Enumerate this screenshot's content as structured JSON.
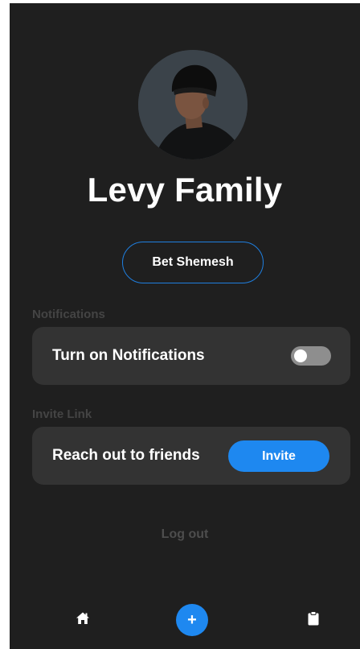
{
  "profile": {
    "family_name": "Levy Family",
    "location": "Bet Shemesh",
    "avatar_icon": "profile-photo"
  },
  "notifications": {
    "section_label": "Notifications",
    "toggle_label": "Turn on Notifications",
    "enabled": false
  },
  "invite": {
    "section_label": "Invite Link",
    "text": "Reach out to friends",
    "button_label": "Invite"
  },
  "logout_label": "Log out",
  "bottom_nav": {
    "home_icon": "home-icon",
    "add_label": "+",
    "clipboard_icon": "clipboard-icon"
  },
  "colors": {
    "background": "#1f1f1f",
    "card": "#333333",
    "accent": "#1e88f0",
    "toggle_off": "#8e8e8e",
    "muted_label": "#444444"
  }
}
